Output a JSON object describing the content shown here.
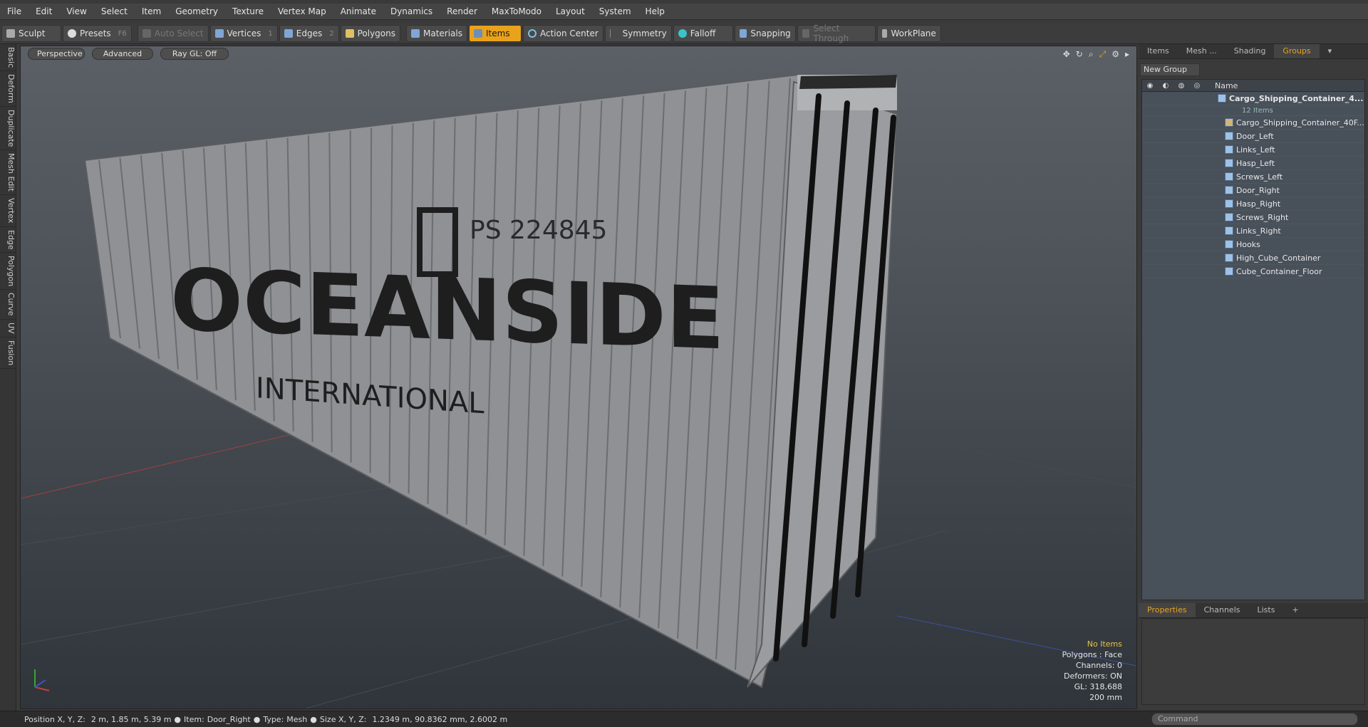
{
  "menu": [
    "File",
    "Edit",
    "View",
    "Select",
    "Item",
    "Geometry",
    "Texture",
    "Vertex Map",
    "Animate",
    "Dynamics",
    "Render",
    "MaxToModo",
    "Layout",
    "System",
    "Help"
  ],
  "toolbar": {
    "sculpt": "Sculpt",
    "presets": "Presets",
    "presets_key": "F6",
    "auto_select": "Auto Select",
    "vertices": "Vertices",
    "vertices_key": "1",
    "edges": "Edges",
    "edges_key": "2",
    "polygons": "Polygons",
    "materials": "Materials",
    "items": "Items",
    "action_center": "Action Center",
    "symmetry": "Symmetry",
    "falloff": "Falloff",
    "snapping": "Snapping",
    "select_through": "Select Through",
    "workplane": "WorkPlane"
  },
  "left_tabs": [
    "Basic",
    "Deform",
    "Duplicate",
    "Mesh Edit",
    "Vertex",
    "Edge",
    "Polygon",
    "Curve",
    "UV",
    "Fusion"
  ],
  "viewport": {
    "view": "Perspective",
    "shading": "Advanced",
    "raygl": "Ray GL: Off",
    "container_text_main": "OCEANSIDE",
    "container_text_sub": "INTERNATIONAL",
    "container_code": "PS 224845",
    "hud": {
      "items": "No Items",
      "polygons": "Polygons : Face",
      "channels": "Channels: 0",
      "deformers": "Deformers: ON",
      "gl": "GL: 318,688",
      "unit": "200 mm"
    }
  },
  "right_panel": {
    "tabs": [
      "Items",
      "Mesh ...",
      "Shading",
      "Groups"
    ],
    "new_group": "New Group",
    "name_header": "Name",
    "root": "Cargo_Shipping_Container_4...",
    "root_sub": "12 Items",
    "items": [
      "Cargo_Shipping_Container_40F...",
      "Door_Left",
      "Links_Left",
      "Hasp_Left",
      "Screws_Left",
      "Door_Right",
      "Hasp_Right",
      "Screws_Right",
      "Links_Right",
      "Hooks",
      "High_Cube_Container",
      "Cube_Container_Floor"
    ],
    "bottom_tabs": [
      "Properties",
      "Channels",
      "Lists"
    ]
  },
  "status": {
    "position_label": "Position X, Y, Z:",
    "position_value": "2 m, 1.85 m, 5.39 m",
    "item_label": "Item:",
    "item_value": "Door_Right",
    "type_label": "Type:",
    "type_value": "Mesh",
    "size_label": "Size X, Y, Z:",
    "size_value": "1.2349 m, 90.8362 mm, 2.6002 m",
    "command_placeholder": "Command"
  },
  "colors": {
    "accent": "#e9a21c",
    "panel": "#3a3a3a",
    "viewport_top": "#5b6066",
    "viewport_bottom": "#2f353a"
  }
}
